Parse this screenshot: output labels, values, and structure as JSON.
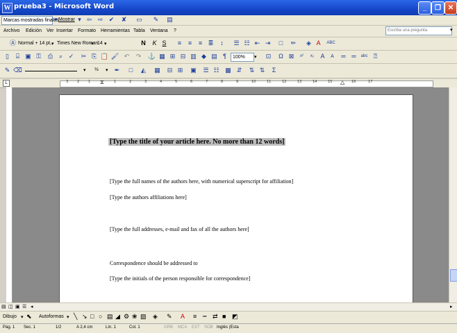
{
  "window": {
    "title": "prueba3 - Microsoft Word",
    "app_icon": "W"
  },
  "review_bar": {
    "view_select": "Marcas mostradas finales",
    "show_label": "Mostrar"
  },
  "menu": {
    "items": [
      "Archivo",
      "Edición",
      "Ver",
      "Insertar",
      "Formato",
      "Herramientas",
      "Tabla",
      "Ventana",
      "?"
    ],
    "help_placeholder": "Escriba una pregunta"
  },
  "format_bar": {
    "style": "Normal + 14 pt,",
    "font": "Times New Roman",
    "size": "14",
    "bold": "N",
    "italic": "K",
    "underline": "S"
  },
  "standard_bar": {
    "zoom": "100%"
  },
  "table_bar": {
    "line_weight": "½"
  },
  "ruler": {
    "ticks": [
      "3",
      "2",
      "1",
      "1",
      "2",
      "3",
      "4",
      "5",
      "6",
      "7",
      "8",
      "9",
      "10",
      "11",
      "12",
      "13",
      "14",
      "15",
      "16",
      "17"
    ]
  },
  "document": {
    "title_placeholder": "[Type the title of your article here. No more than 12 words]",
    "authors": "[Type the full names of the authors here, with numerical superscript for affiliation]",
    "affiliations": "[Type the authors affiliations here]",
    "addresses": "[Type the full addresses, e-mail and fax of all the authors here]",
    "correspondence": "Correspondence should be addressed to",
    "initials": "[Type the initials of the person responsible for correspondence]"
  },
  "drawing_bar": {
    "draw_label": "Dibujo",
    "autoshapes_label": "Autoformas"
  },
  "status": {
    "page": "Pág. 1",
    "section": "Sec. 1",
    "pages": "1/2",
    "position": "A 2,4 cm",
    "line": "Lín. 1",
    "column": "Col. 1",
    "grb": "GRB",
    "mca": "MCA",
    "ext": "EXT",
    "sob": "SOB",
    "language": "Inglés (Esta"
  }
}
